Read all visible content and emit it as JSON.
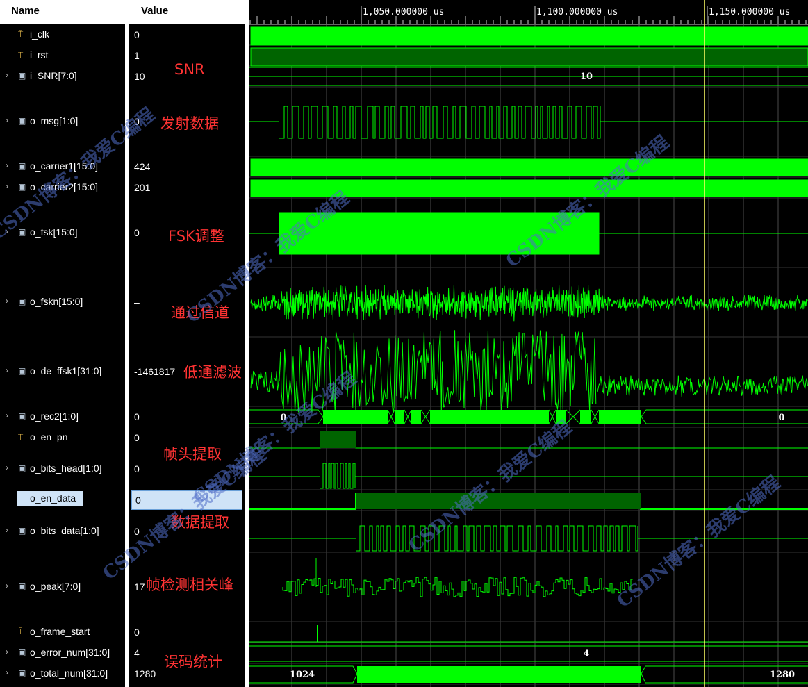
{
  "headers": {
    "name": "Name",
    "value": "Value"
  },
  "time_labels": [
    "1,050.000000 us",
    "1,100.000000 us",
    "1,150.000000 us"
  ],
  "signals": [
    {
      "name": "i_clk",
      "value": "0",
      "kind": "bit",
      "expandable": false
    },
    {
      "name": "i_rst",
      "value": "1",
      "kind": "bit",
      "expandable": false
    },
    {
      "name": "i_SNR[7:0]",
      "value": "10",
      "kind": "bus",
      "expandable": true
    },
    {
      "name": "o_msg[1:0]",
      "value": "0",
      "kind": "bus",
      "expandable": true
    },
    {
      "name": "o_carrier1[15:0]",
      "value": "424",
      "kind": "bus",
      "expandable": true
    },
    {
      "name": "o_carrier2[15:0]",
      "value": "201",
      "kind": "bus",
      "expandable": true
    },
    {
      "name": "o_fsk[15:0]",
      "value": "0",
      "kind": "bus",
      "expandable": true
    },
    {
      "name": "o_fskn[15:0]",
      "value": "–",
      "kind": "bus",
      "expandable": true
    },
    {
      "name": "o_de_ffsk1[31:0]",
      "value": "-1461817",
      "kind": "bus",
      "expandable": true
    },
    {
      "name": "o_rec2[1:0]",
      "value": "0",
      "kind": "bus",
      "expandable": true
    },
    {
      "name": "o_en_pn",
      "value": "0",
      "kind": "bit",
      "expandable": false
    },
    {
      "name": "o_bits_head[1:0]",
      "value": "0",
      "kind": "bus",
      "expandable": true
    },
    {
      "name": "o_en_data",
      "value": "0",
      "kind": "bit",
      "expandable": false,
      "selected": true
    },
    {
      "name": "o_bits_data[1:0]",
      "value": "0",
      "kind": "bus",
      "expandable": true
    },
    {
      "name": "o_peak[7:0]",
      "value": "17",
      "kind": "bus",
      "expandable": true
    },
    {
      "name": "o_frame_start",
      "value": "0",
      "kind": "bit",
      "expandable": false
    },
    {
      "name": "o_error_num[31:0]",
      "value": "4",
      "kind": "bus",
      "expandable": true
    },
    {
      "name": "o_total_num[31:0]",
      "value": "1280",
      "kind": "bus",
      "expandable": true
    }
  ],
  "bus_labels": {
    "snr": "10",
    "rec2_left": "0",
    "rec2_right": "0",
    "error_num": "4",
    "total_left": "1024",
    "total_right": "1280"
  },
  "annotations": {
    "snr": "SNR",
    "msg": "发射数据",
    "fsk": "FSK调整",
    "fskn": "通过信道",
    "lpf": "低通滤波",
    "frame_head": "帧头提取",
    "data_extract": "数据提取",
    "peak": "帧检测相关峰",
    "ber": "误码统计"
  },
  "watermark": "CSDN博客：我爱C编程",
  "colors": {
    "wave": "#00ff00",
    "wave_dark": "#006400",
    "cursor": "#ffff66",
    "annotation": "#ff3333",
    "selection": "#cfe3f7"
  }
}
